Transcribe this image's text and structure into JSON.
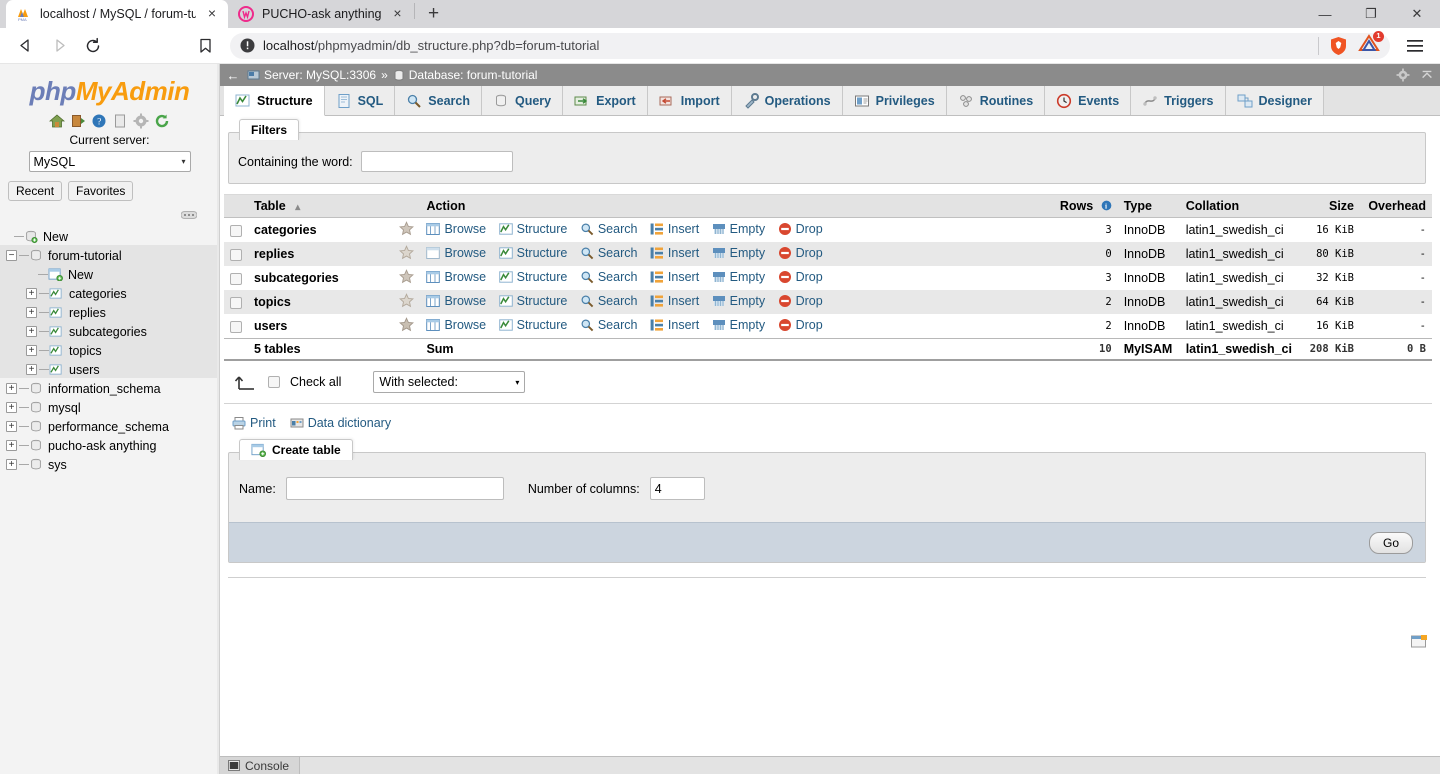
{
  "browser": {
    "tabs": [
      {
        "title": "localhost / MySQL / forum-tutorial",
        "favicon": "phpmyadmin-icon",
        "active": true,
        "close_label": "×"
      },
      {
        "title": "PUCHO-ask anything",
        "favicon": "pucho-icon",
        "active": false,
        "close_label": "×"
      }
    ],
    "new_tab_label": "+",
    "window_buttons": {
      "minimize": "—",
      "maximize": "❐",
      "close": "✕"
    },
    "nav": {
      "back_label": "◁",
      "forward_label": "▷",
      "reload_label": "⟳",
      "bookmark_label": "bookmark"
    },
    "url": {
      "scheme_icon": "not-secure-icon",
      "host": "localhost",
      "path": "/phpmyadmin/db_structure.php?db=forum-tutorial",
      "full": "localhost/phpmyadmin/db_structure.php?db=forum-tutorial"
    },
    "shield_icon": "brave-shields-icon",
    "extension_icon": "extension-icon",
    "extension_badge": "1",
    "menu_label": "☰"
  },
  "sidebar": {
    "logo": {
      "php": "php",
      "my": "My",
      "admin": "Admin"
    },
    "quick_icons": [
      "home-icon",
      "logout-icon",
      "docs-icon",
      "sql-docs-icon",
      "settings-icon",
      "refresh-icon"
    ],
    "current_server_label": "Current server:",
    "server_select": {
      "value": "MySQL",
      "caret": "▾"
    },
    "recent_label": "Recent",
    "favorites_label": "Favorites",
    "tree": [
      {
        "label": "New",
        "type": "new-db",
        "depth": 1,
        "toggle": "",
        "highlight": false
      },
      {
        "label": "forum-tutorial",
        "type": "db",
        "depth": 0,
        "toggle": "−",
        "highlight": true
      },
      {
        "label": "New",
        "type": "new-table",
        "depth": 2,
        "toggle": "",
        "highlight": true
      },
      {
        "label": "categories",
        "type": "table",
        "depth": 2,
        "toggle": "+",
        "highlight": true
      },
      {
        "label": "replies",
        "type": "table",
        "depth": 2,
        "toggle": "+",
        "highlight": true
      },
      {
        "label": "subcategories",
        "type": "table",
        "depth": 2,
        "toggle": "+",
        "highlight": true
      },
      {
        "label": "topics",
        "type": "table",
        "depth": 2,
        "toggle": "+",
        "highlight": true
      },
      {
        "label": "users",
        "type": "table",
        "depth": 2,
        "toggle": "+",
        "highlight": true
      },
      {
        "label": "information_schema",
        "type": "db",
        "depth": 0,
        "toggle": "+",
        "highlight": false
      },
      {
        "label": "mysql",
        "type": "db",
        "depth": 0,
        "toggle": "+",
        "highlight": false
      },
      {
        "label": "performance_schema",
        "type": "db",
        "depth": 0,
        "toggle": "+",
        "highlight": false
      },
      {
        "label": "pucho-ask anything",
        "type": "db",
        "depth": 0,
        "toggle": "+",
        "highlight": false
      },
      {
        "label": "sys",
        "type": "db",
        "depth": 0,
        "toggle": "+",
        "highlight": false
      }
    ]
  },
  "breadcrumb": {
    "back_label": "←",
    "server_label": "Server: MySQL:3306",
    "separator": "»",
    "database_label": "Database: forum-tutorial",
    "settings_icon": "gear-icon",
    "collapse_icon": "collapse-icon"
  },
  "tabs": [
    {
      "label": "Structure",
      "icon": "structure-icon",
      "active": true
    },
    {
      "label": "SQL",
      "icon": "sql-icon",
      "active": false
    },
    {
      "label": "Search",
      "icon": "search-icon",
      "active": false
    },
    {
      "label": "Query",
      "icon": "query-icon",
      "active": false
    },
    {
      "label": "Export",
      "icon": "export-icon",
      "active": false
    },
    {
      "label": "Import",
      "icon": "import-icon",
      "active": false
    },
    {
      "label": "Operations",
      "icon": "operations-icon",
      "active": false
    },
    {
      "label": "Privileges",
      "icon": "privileges-icon",
      "active": false
    },
    {
      "label": "Routines",
      "icon": "routines-icon",
      "active": false
    },
    {
      "label": "Events",
      "icon": "events-icon",
      "active": false
    },
    {
      "label": "Triggers",
      "icon": "triggers-icon",
      "active": false
    },
    {
      "label": "Designer",
      "icon": "designer-icon",
      "active": false
    }
  ],
  "filters": {
    "legend": "Filters",
    "containing_label": "Containing the word:",
    "containing_value": "",
    "containing_placeholder": ""
  },
  "table_list": {
    "columns": [
      "Table",
      "Action",
      "Rows",
      "Type",
      "Collation",
      "Size",
      "Overhead"
    ],
    "sort_indicator": "▴",
    "rows_help_icon": "help-icon",
    "actions": [
      "Browse",
      "Structure",
      "Search",
      "Insert",
      "Empty",
      "Drop"
    ],
    "rows": [
      {
        "name": "categories",
        "rows": "3",
        "type": "InnoDB",
        "collation": "latin1_swedish_ci",
        "size": "16 KiB",
        "overhead": "-"
      },
      {
        "name": "replies",
        "rows": "0",
        "type": "InnoDB",
        "collation": "latin1_swedish_ci",
        "size": "80 KiB",
        "overhead": "-"
      },
      {
        "name": "subcategories",
        "rows": "3",
        "type": "InnoDB",
        "collation": "latin1_swedish_ci",
        "size": "32 KiB",
        "overhead": "-"
      },
      {
        "name": "topics",
        "rows": "2",
        "type": "InnoDB",
        "collation": "latin1_swedish_ci",
        "size": "64 KiB",
        "overhead": "-"
      },
      {
        "name": "users",
        "rows": "2",
        "type": "InnoDB",
        "collation": "latin1_swedish_ci",
        "size": "16 KiB",
        "overhead": "-"
      }
    ],
    "summary": {
      "count_label": "5 tables",
      "sum_label": "Sum",
      "rows": "10",
      "type": "MyISAM",
      "collation": "latin1_swedish_ci",
      "size": "208 KiB",
      "overhead": "0 B"
    }
  },
  "bulk": {
    "check_all_label": "Check all",
    "with_selected": {
      "value": "With selected:",
      "caret": "▾"
    }
  },
  "links": {
    "print_label": "Print",
    "data_dictionary_label": "Data dictionary"
  },
  "create_table": {
    "legend": "Create table",
    "name_label": "Name:",
    "name_value": "",
    "columns_label": "Number of columns:",
    "columns_value": "4",
    "go_label": "Go"
  },
  "console": {
    "label": "Console",
    "icon": "console-icon"
  },
  "colors": {
    "breadcrumb_bg": "#8b8b8b",
    "link": "#235a81",
    "accent_orange": "#f89c0e",
    "accent_blue": "#6c7eb7",
    "panel_footer": "#ccd5df",
    "badge_red": "#e23b2e"
  }
}
